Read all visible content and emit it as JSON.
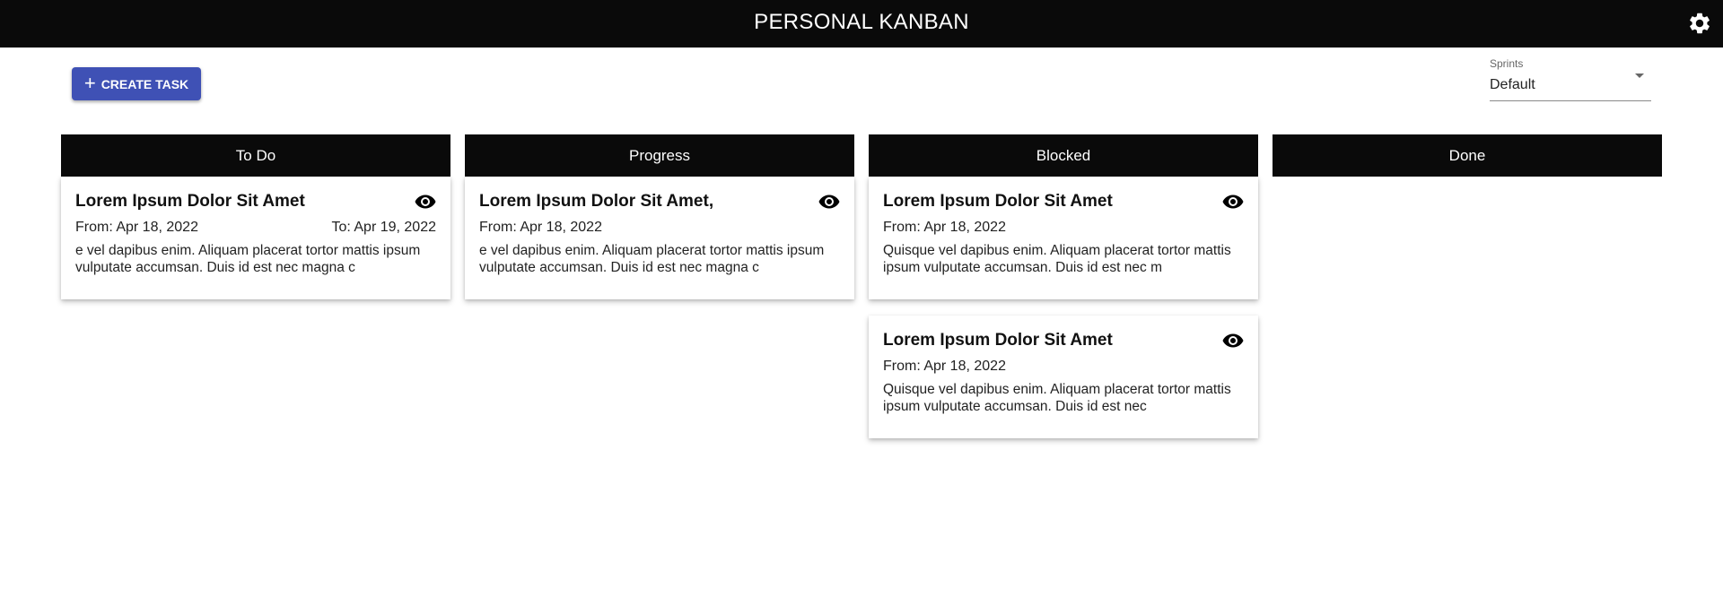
{
  "header": {
    "title": "PERSONAL KANBAN",
    "settings_icon": "gear-icon"
  },
  "toolbar": {
    "create_label": "CREATE TASK",
    "create_icon": "plus-icon",
    "accent_color": "#3f51b5"
  },
  "sprints": {
    "label": "Sprints",
    "value": "Default"
  },
  "columns": [
    {
      "title": "To Do",
      "cards": [
        {
          "title": "Lorem Ipsum Dolor Sit Amet",
          "from": "From: Apr 18, 2022",
          "to": "To: Apr 19, 2022",
          "desc": "e vel dapibus enim. Aliquam placerat tortor mattis ipsum vulputate accumsan. Duis id est nec magna c"
        }
      ]
    },
    {
      "title": "Progress",
      "cards": [
        {
          "title": "Lorem Ipsum Dolor Sit Amet,",
          "from": "From: Apr 18, 2022",
          "desc": "e vel dapibus enim. Aliquam placerat tortor mattis ipsum vulputate accumsan. Duis id est nec magna c"
        }
      ]
    },
    {
      "title": "Blocked",
      "cards": [
        {
          "title": "Lorem Ipsum Dolor Sit Amet",
          "from": "From: Apr 18, 2022",
          "desc": "Quisque vel dapibus enim. Aliquam placerat tortor mattis ipsum vulputate accumsan. Duis id est nec m"
        },
        {
          "title": "Lorem Ipsum Dolor Sit Amet",
          "from": "From: Apr 18, 2022",
          "desc": "Quisque vel dapibus enim. Aliquam placerat tortor mattis ipsum vulputate accumsan. Duis id est nec"
        }
      ]
    },
    {
      "title": "Done",
      "cards": []
    }
  ]
}
